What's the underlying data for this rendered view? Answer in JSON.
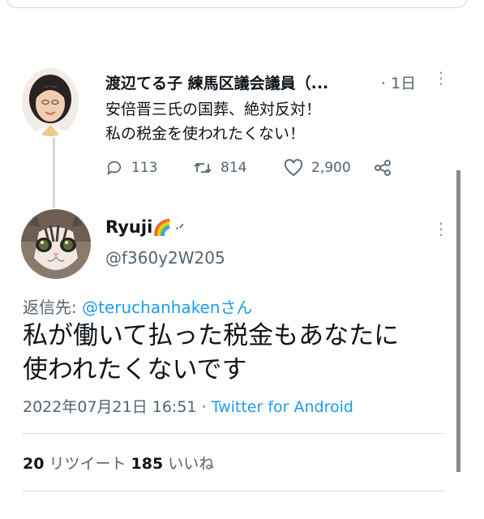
{
  "original_tweet": {
    "display_name": "渡辺てる子 練馬区議会議員（...",
    "time": "· 1日",
    "more": "⋮",
    "text": "安倍晋三氏の国葬、絶対反対！\n私の税金を使われたくない！",
    "reply_count": "113",
    "retweet_count": "814",
    "like_count": "2,900"
  },
  "reply_tweet": {
    "display_name": "Ryuji",
    "name_emoji": "🌈",
    "name_symbol": "·ᐟ",
    "handle": "@f360y2W205",
    "more": "⋮",
    "reply_to_label": "返信先: ",
    "reply_to_handle": "@teruchanhaken",
    "reply_to_suffix": "さん",
    "text": "私が働いて払った税金もあなたに\n使われたくないです",
    "date": "2022年07月21日 16:51 · ",
    "source": "Twitter for Android",
    "retweets": "20",
    "retweets_label": " リツイート ",
    "likes": "185",
    "likes_label": " いいね"
  },
  "colors": {
    "link": "#1d9bf0",
    "muted": "#536471",
    "border": "#cfd9de",
    "text": "#0f1419"
  },
  "icons": [
    "reply-icon",
    "retweet-icon",
    "like-icon",
    "share-icon",
    "more-icon"
  ]
}
